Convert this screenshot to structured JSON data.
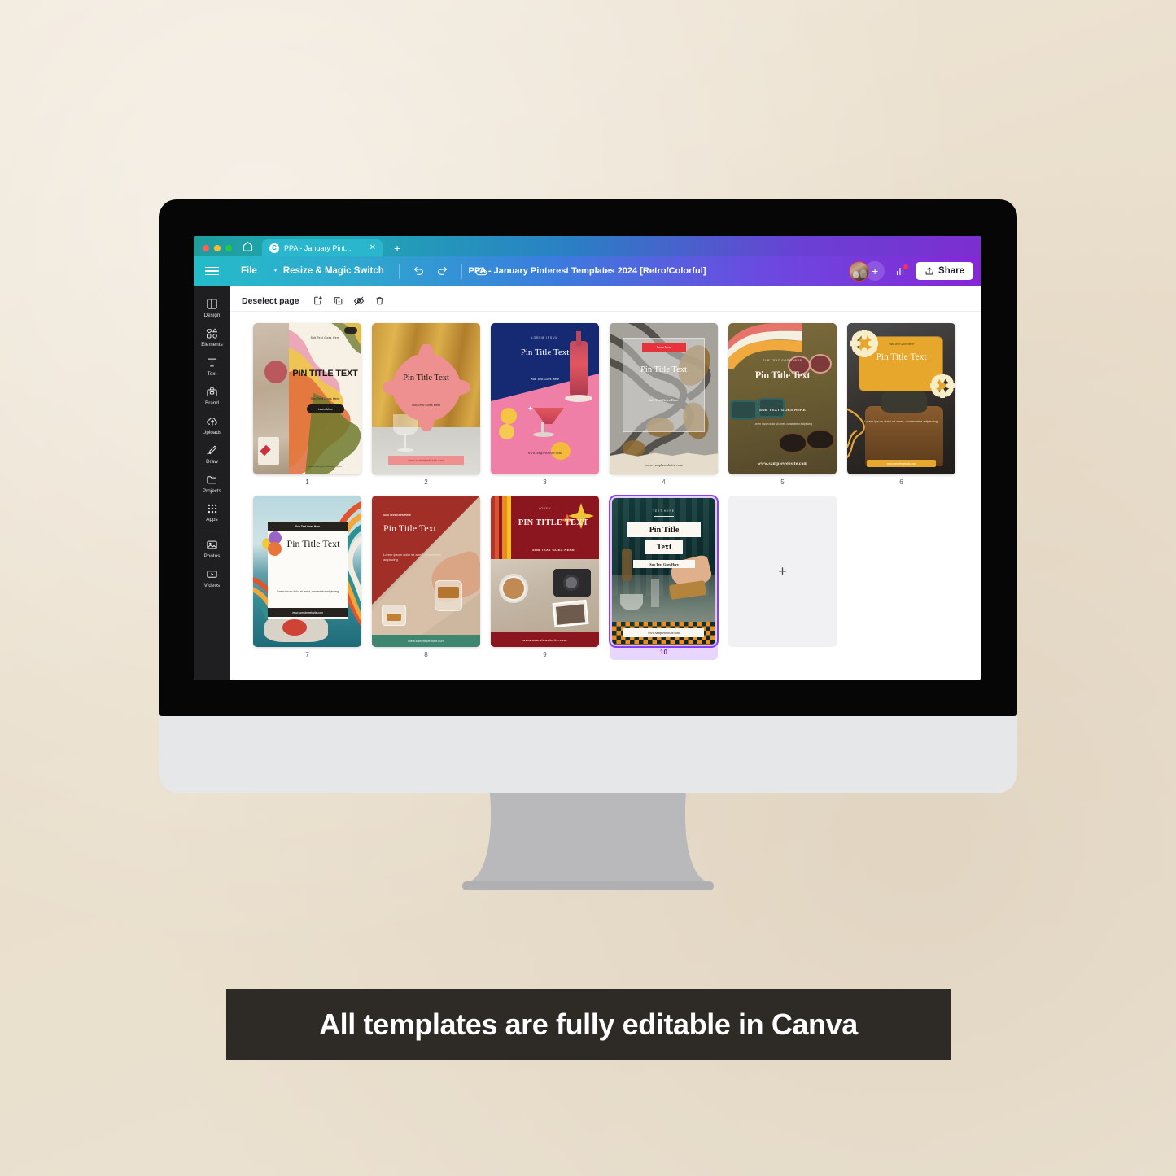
{
  "browser": {
    "tab": {
      "title": "PPA - January Pint...",
      "favicon": "C",
      "close_icon": "close-icon"
    },
    "new_tab_icon": "plus-icon",
    "home_icon": "home-icon"
  },
  "toolbar": {
    "menu_icon": "hamburger-icon",
    "file_label": "File",
    "resize_label": "Resize & Magic Switch",
    "undo_icon": "undo-icon",
    "redo_icon": "redo-icon",
    "cloud_icon": "cloud-check-icon",
    "doc_title": "PPA - January Pinterest Templates 2024 [Retro/Colorful]",
    "avatar": "user-avatar",
    "add_collaborator_label": "+",
    "insights_icon": "bar-chart-icon",
    "share_label": "Share",
    "share_icon": "share-upload-icon",
    "accent_purple": "#8526d6",
    "accent_teal": "#24bcc9"
  },
  "sidebar": {
    "items": [
      {
        "label": "Design",
        "icon": "layout-icon"
      },
      {
        "label": "Elements",
        "icon": "shapes-icon"
      },
      {
        "label": "Text",
        "icon": "text-t-icon"
      },
      {
        "label": "Brand",
        "icon": "brand-kit-icon"
      },
      {
        "label": "Uploads",
        "icon": "upload-cloud-icon"
      },
      {
        "label": "Draw",
        "icon": "pen-icon"
      },
      {
        "label": "Projects",
        "icon": "folder-icon"
      },
      {
        "label": "Apps",
        "icon": "grid-dots-icon"
      },
      {
        "label": "Photos",
        "icon": "photo-icon"
      },
      {
        "label": "Videos",
        "icon": "video-icon"
      }
    ]
  },
  "page_toolbar": {
    "deselect_label": "Deselect page",
    "add_page_icon": "add-page-icon",
    "duplicate_icon": "duplicate-page-icon",
    "hide_icon": "eye-slash-icon",
    "delete_icon": "trash-icon"
  },
  "pages": [
    {
      "number": "1",
      "selected": false,
      "title": "PIN TITLE TEXT",
      "subtitle": "Sub Text Goes Here",
      "button": "Learn More",
      "url": "www.samplewebsite.com"
    },
    {
      "number": "2",
      "selected": false,
      "title": "Pin Title Text",
      "subtitle": "Sub Text Goes Here",
      "url": "www.samplewebsite.com"
    },
    {
      "number": "3",
      "selected": false,
      "title": "Pin Title Text",
      "subtitle": "Sub Text Goes Here",
      "eyebrow": "LOREM IPSUM",
      "url": "www.samplewebsite.com"
    },
    {
      "number": "4",
      "selected": false,
      "title": "Pin Title Text",
      "subtitle": "Sub Text Goes Here",
      "button": "Learn More",
      "url": "www.samplewebsite.com"
    },
    {
      "number": "5",
      "selected": false,
      "title": "Pin Title Text",
      "subtitle": "SUB TEXT GOES HERE",
      "eyebrow": "SUB TEXT GOES HERE",
      "body": "Lorem ipsum dolor sit amet, consectetur adipiscing",
      "url": "www.samplewebsite.com"
    },
    {
      "number": "6",
      "selected": false,
      "title": "Pin Title Text",
      "subtitle": "Sub Text Goes Here",
      "body": "Lorem ipsum dolor sit amet, consectetur adipiscing",
      "url": "www.samplewebsite.com"
    },
    {
      "number": "7",
      "selected": false,
      "title": "Pin Title Text",
      "subtitle": "Sub Text Goes Here",
      "body": "Lorem ipsum dolor sit amet, consectetur adipiscing",
      "url": "www.samplewebsite.com"
    },
    {
      "number": "8",
      "selected": false,
      "title": "Pin Title Text",
      "subtitle": "Sub Text Goes Here",
      "body": "Lorem ipsum dolor sit amet, consectetur adipiscing",
      "url": "www.samplewebsite.com"
    },
    {
      "number": "9",
      "selected": false,
      "title": "PIN TITLE TEXT",
      "subtitle": "SUB TEXT GOES HERE",
      "eyebrow": "LOREM",
      "url": "www.samplewebsite.com"
    },
    {
      "number": "10",
      "selected": true,
      "title": "Pin Title Text",
      "subtitle": "Sub Text Goes Here",
      "eyebrow": "TEXT HERE",
      "url": "www.samplewebsite.com"
    }
  ],
  "add_page": {
    "icon": "plus-icon"
  },
  "caption": {
    "text": "All templates are fully editable in Canva",
    "bg": "#2e2a26",
    "color": "#ffffff"
  }
}
